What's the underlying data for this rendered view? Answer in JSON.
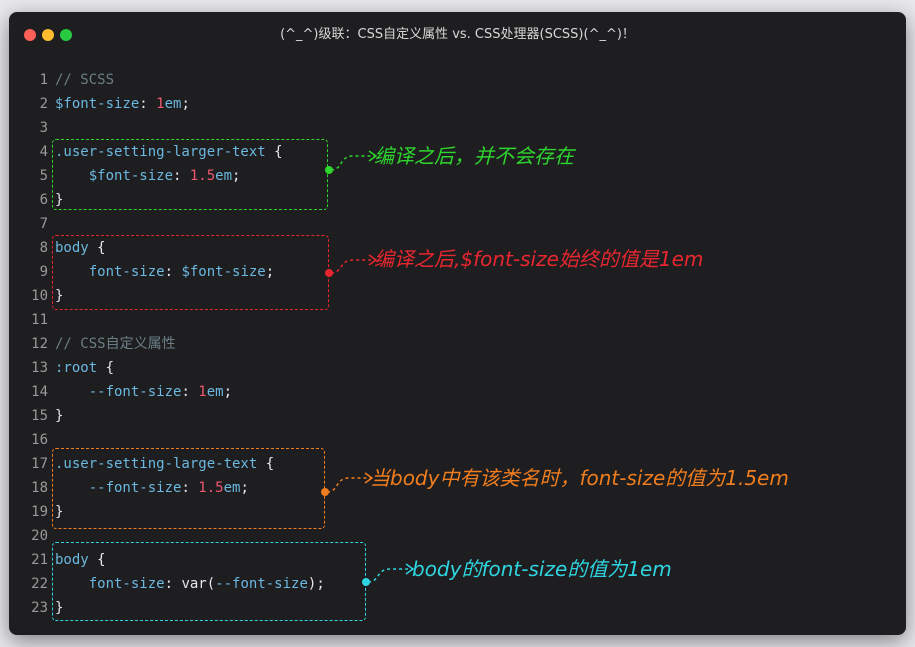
{
  "window": {
    "title": "(^_^)级联：CSS自定义属性 vs. CSS处理器(SCSS)(^_^)！"
  },
  "code": {
    "lines": [
      {
        "n": "1",
        "tokens": [
          {
            "t": "// SCSS",
            "c": "comment"
          }
        ]
      },
      {
        "n": "2",
        "tokens": [
          {
            "t": "$font-size",
            "c": "var"
          },
          {
            "t": ": ",
            "c": "punc"
          },
          {
            "t": "1",
            "c": "num"
          },
          {
            "t": "em",
            "c": "unit"
          },
          {
            "t": ";",
            "c": "punc"
          }
        ]
      },
      {
        "n": "3",
        "tokens": []
      },
      {
        "n": "4",
        "tokens": [
          {
            "t": ".user-setting-larger-text",
            "c": "sel"
          },
          {
            "t": " {",
            "c": "punc"
          }
        ]
      },
      {
        "n": "5",
        "tokens": [
          {
            "t": "    ",
            "c": "punc"
          },
          {
            "t": "$font-size",
            "c": "var"
          },
          {
            "t": ": ",
            "c": "punc"
          },
          {
            "t": "1.5",
            "c": "num"
          },
          {
            "t": "em",
            "c": "unit"
          },
          {
            "t": ";",
            "c": "punc"
          }
        ]
      },
      {
        "n": "6",
        "tokens": [
          {
            "t": "}",
            "c": "punc"
          }
        ]
      },
      {
        "n": "7",
        "tokens": []
      },
      {
        "n": "8",
        "tokens": [
          {
            "t": "body",
            "c": "sel"
          },
          {
            "t": " {",
            "c": "punc"
          }
        ]
      },
      {
        "n": "9",
        "tokens": [
          {
            "t": "    ",
            "c": "punc"
          },
          {
            "t": "font-size",
            "c": "prop"
          },
          {
            "t": ": ",
            "c": "punc"
          },
          {
            "t": "$font-size",
            "c": "var"
          },
          {
            "t": ";",
            "c": "punc"
          }
        ]
      },
      {
        "n": "10",
        "tokens": [
          {
            "t": "}",
            "c": "punc"
          }
        ]
      },
      {
        "n": "11",
        "tokens": []
      },
      {
        "n": "12",
        "tokens": [
          {
            "t": "// CSS自定义属性",
            "c": "comment"
          }
        ]
      },
      {
        "n": "13",
        "tokens": [
          {
            "t": ":root",
            "c": "sel"
          },
          {
            "t": " {",
            "c": "punc"
          }
        ]
      },
      {
        "n": "14",
        "tokens": [
          {
            "t": "    ",
            "c": "punc"
          },
          {
            "t": "--font-size",
            "c": "prop"
          },
          {
            "t": ": ",
            "c": "punc"
          },
          {
            "t": "1",
            "c": "num"
          },
          {
            "t": "em",
            "c": "unit"
          },
          {
            "t": ";",
            "c": "punc"
          }
        ]
      },
      {
        "n": "15",
        "tokens": [
          {
            "t": "}",
            "c": "punc"
          }
        ]
      },
      {
        "n": "16",
        "tokens": []
      },
      {
        "n": "17",
        "tokens": [
          {
            "t": ".user-setting-large-text",
            "c": "sel"
          },
          {
            "t": " {",
            "c": "punc"
          }
        ]
      },
      {
        "n": "18",
        "tokens": [
          {
            "t": "    ",
            "c": "punc"
          },
          {
            "t": "--font-size",
            "c": "prop"
          },
          {
            "t": ": ",
            "c": "punc"
          },
          {
            "t": "1.5",
            "c": "num"
          },
          {
            "t": "em",
            "c": "unit"
          },
          {
            "t": ";",
            "c": "punc"
          }
        ]
      },
      {
        "n": "19",
        "tokens": [
          {
            "t": "}",
            "c": "punc"
          }
        ]
      },
      {
        "n": "20",
        "tokens": []
      },
      {
        "n": "21",
        "tokens": [
          {
            "t": "body",
            "c": "sel"
          },
          {
            "t": " {",
            "c": "punc"
          }
        ]
      },
      {
        "n": "22",
        "tokens": [
          {
            "t": "    ",
            "c": "punc"
          },
          {
            "t": "font-size",
            "c": "prop"
          },
          {
            "t": ": ",
            "c": "punc"
          },
          {
            "t": "var",
            "c": "func"
          },
          {
            "t": "(",
            "c": "punc"
          },
          {
            "t": "--font-size",
            "c": "prop"
          },
          {
            "t": ");",
            "c": "punc"
          }
        ]
      },
      {
        "n": "23",
        "tokens": [
          {
            "t": "}",
            "c": "punc"
          }
        ]
      }
    ]
  },
  "annotations": [
    {
      "text": "编译之后，并不会存在",
      "color": "#2ed52e"
    },
    {
      "text": "编译之后,$font-size始终的值是1em",
      "color": "#e8262f"
    },
    {
      "text": "当body中有该类名时，font-size的值为1.5em",
      "color": "#f07d1e"
    },
    {
      "text": "body的font-size的值为1em",
      "color": "#2ed5e0"
    }
  ]
}
